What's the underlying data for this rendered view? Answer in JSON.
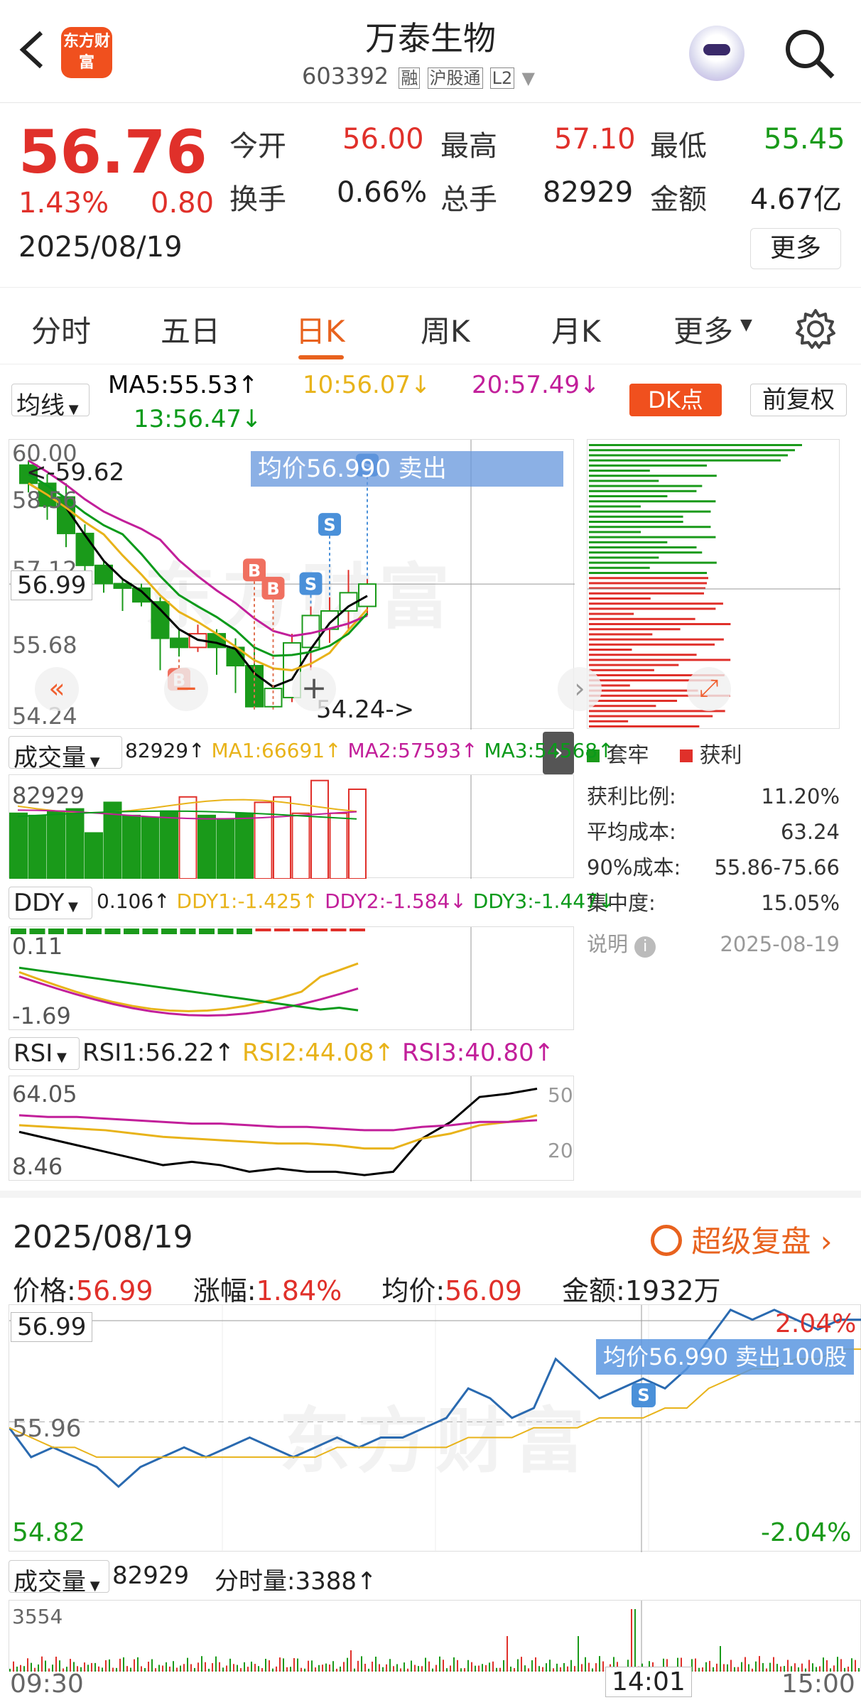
{
  "header": {
    "title": "万泰生物",
    "code": "603392",
    "tags": [
      "融",
      "沪股通",
      "L2"
    ],
    "logo": "东方财富",
    "back_icon": "back-arrow-icon",
    "search_icon": "search-icon",
    "avatar_icon": "robot-avatar-icon"
  },
  "quote": {
    "price": "56.76",
    "change_pct": "1.43%",
    "change": "0.80",
    "date": "2025/08/19",
    "open_label": "今开",
    "open": "56.00",
    "high_label": "最高",
    "high": "57.10",
    "low_label": "最低",
    "low": "55.45",
    "turnover_label": "换手",
    "turnover": "0.66%",
    "volume_label": "总手",
    "volume": "82929",
    "amount_label": "金额",
    "amount": "4.67亿",
    "more_button": "更多"
  },
  "tabs": [
    "分时",
    "五日",
    "日K",
    "周K",
    "月K",
    "更多"
  ],
  "active_tab": "日K",
  "kline": {
    "ma_dropdown": "均线",
    "ma5": "MA5:55.53↑",
    "ma10": "10:56.07↓",
    "ma20": "20:57.49↓",
    "ma30": "13:56.47↓",
    "dk_button": "DK点",
    "fq_button": "前复权",
    "y_labels": [
      "60.00",
      "58.56",
      "57.12",
      "55.68",
      "54.24"
    ],
    "price_marker": "56.99",
    "left_label": "<-59.62",
    "low_label": "54.24->",
    "tooltip": "均价56.990 卖出",
    "buy_marks": [
      "B",
      "B",
      "B"
    ],
    "sell_marks": [
      "S",
      "S",
      "S"
    ]
  },
  "chip_dist": {
    "legend_trapped": "套牢",
    "legend_profit": "获利",
    "profit_ratio_label": "获利比例:",
    "profit_ratio": "11.20%",
    "avg_cost_label": "平均成本:",
    "avg_cost": "63.24",
    "cost90_label": "90%成本:",
    "cost90": "55.86-75.66",
    "concentration_label": "集中度:",
    "concentration": "15.05%",
    "note_label": "说明",
    "note_date": "2025-08-19"
  },
  "volume": {
    "dropdown": "成交量",
    "value": "82929↑",
    "ma1": "MA1:66691↑",
    "ma2": "MA2:57593↑",
    "ma3": "MA3:54568↑",
    "y_label": "82929"
  },
  "ddy": {
    "dropdown": "DDY",
    "value": "0.106↑",
    "ddy1": "DDY1:-1.425↑",
    "ddy2": "DDY2:-1.584↓",
    "ddy3": "DDY3:-1.447↓",
    "y_top": "0.11",
    "y_bottom": "-1.69"
  },
  "rsi": {
    "dropdown": "RSI",
    "rsi1": "RSI1:56.22↑",
    "rsi2": "RSI2:44.08↑",
    "rsi3": "RSI3:40.80↑",
    "y_top": "64.05",
    "y_bottom": "8.46",
    "right_top": "50",
    "right_bottom": "20"
  },
  "intraday": {
    "date": "2025/08/19",
    "replay_button": "超级复盘",
    "price_label": "价格:",
    "price": "56.99",
    "change_label": "涨幅:",
    "change": "1.84%",
    "avg_label": "均价:",
    "avg": "56.09",
    "amount_label": "金额:",
    "amount": "1932万",
    "y_top": "56.99",
    "y_mid": "55.96",
    "y_bottom": "54.82",
    "pct_top": "2.04%",
    "pct_bottom": "-2.04%",
    "tooltip": "均价56.990 卖出100股",
    "sell_mark": "S",
    "watermark": "东方财富"
  },
  "intraday_vol": {
    "dropdown": "成交量",
    "value": "82929",
    "tick_label": "分时量:3388↑",
    "y_label": "3554",
    "time_start": "09:30",
    "time_mid": "14:01",
    "time_end": "15:00"
  },
  "colors": {
    "up": "#e0302a",
    "down": "#1a9a1a",
    "accent": "#e8621e",
    "ma5": "#000000",
    "ma10": "#e8b31a",
    "ma20": "#c21f9a",
    "ma30": "#0a9a1a"
  },
  "chart_data": {
    "type": "candlestick",
    "candles": [
      [
        59.6,
        59.2,
        59.7,
        59.0
      ],
      [
        59.2,
        58.7,
        59.4,
        58.4
      ],
      [
        58.9,
        58.1,
        59.2,
        57.8
      ],
      [
        58.1,
        57.4,
        58.3,
        57.0
      ],
      [
        57.4,
        57.0,
        57.5,
        56.8
      ],
      [
        57.0,
        56.9,
        57.1,
        56.4
      ],
      [
        56.9,
        56.6,
        57.0,
        56.5
      ],
      [
        56.6,
        55.8,
        56.7,
        55.1
      ],
      [
        55.8,
        55.6,
        56.0,
        55.4
      ],
      [
        55.6,
        55.9,
        56.1,
        55.5
      ],
      [
        55.9,
        55.6,
        56.0,
        55.0
      ],
      [
        55.6,
        55.2,
        55.8,
        54.6
      ],
      [
        55.2,
        54.3,
        55.6,
        54.24
      ],
      [
        54.3,
        54.7,
        54.7,
        54.24
      ],
      [
        54.5,
        55.7,
        55.9,
        54.4
      ],
      [
        55.6,
        56.3,
        56.5,
        55.1
      ],
      [
        56.0,
        56.4,
        56.7,
        55.7
      ],
      [
        56.4,
        56.8,
        57.3,
        56.0
      ],
      [
        56.5,
        56.99,
        57.1,
        56.3
      ]
    ],
    "volumes": [
      60,
      58,
      62,
      64,
      42,
      70,
      58,
      56,
      62,
      75,
      58,
      55,
      60,
      70,
      75,
      60,
      90,
      60,
      82
    ],
    "up_flags": [
      0,
      0,
      0,
      0,
      0,
      0,
      0,
      0,
      0,
      1,
      0,
      0,
      0,
      1,
      1,
      1,
      1,
      1,
      1
    ],
    "intraday_price": [
      55.9,
      55.6,
      55.7,
      55.6,
      55.5,
      55.3,
      55.5,
      55.6,
      55.7,
      55.6,
      55.7,
      55.8,
      55.7,
      55.6,
      55.7,
      55.8,
      55.7,
      55.8,
      55.8,
      55.9,
      56.0,
      56.3,
      56.2,
      56.0,
      56.1,
      56.6,
      56.4,
      56.2,
      56.3,
      56.4,
      56.3,
      56.5,
      56.8,
      57.1,
      57.0,
      57.1,
      57.0,
      56.9,
      57.0,
      57.0
    ],
    "intraday_avg": [
      55.9,
      55.8,
      55.7,
      55.7,
      55.6,
      55.6,
      55.6,
      55.6,
      55.6,
      55.6,
      55.6,
      55.6,
      55.6,
      55.6,
      55.6,
      55.7,
      55.7,
      55.7,
      55.7,
      55.7,
      55.7,
      55.8,
      55.8,
      55.8,
      55.9,
      55.9,
      55.9,
      56.0,
      56.0,
      56.0,
      56.1,
      56.1,
      56.3,
      56.4,
      56.5,
      56.5,
      56.6,
      56.6,
      56.7,
      56.7
    ]
  }
}
